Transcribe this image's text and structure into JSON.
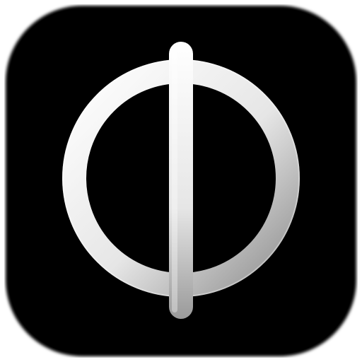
{
  "icon": {
    "name": "phi-icon",
    "background_color": "#000000",
    "glyph_color_light": "#ffffff",
    "glyph_color_mid": "#e6e6e6",
    "glyph_color_dark": "#8e8e8e"
  }
}
